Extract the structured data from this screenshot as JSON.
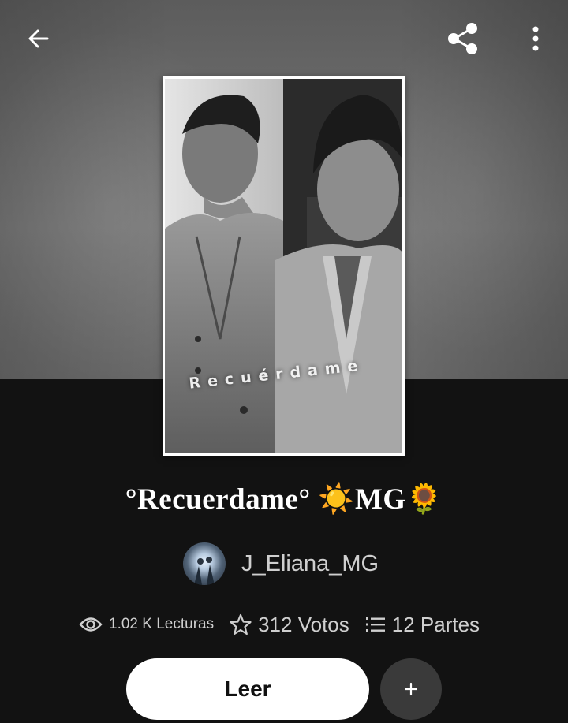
{
  "topbar": {
    "back_icon": "arrow-left-icon",
    "share_icon": "share-icon",
    "more_icon": "more-vertical-icon"
  },
  "cover": {
    "text": "Recuérdame"
  },
  "story": {
    "title": "°Recuerdame° ☀️MG🌻"
  },
  "author": {
    "name": "J_Eliana_MG"
  },
  "stats": {
    "reads": "1.02 K Lecturas",
    "votes": "312 Votos",
    "parts": "12 Partes"
  },
  "actions": {
    "read_label": "Leer",
    "add_label": "+"
  },
  "colors": {
    "background": "#121212",
    "read_button": "#ffffff",
    "add_button": "#3a3a3a",
    "muted_text": "#cfcfcf"
  }
}
